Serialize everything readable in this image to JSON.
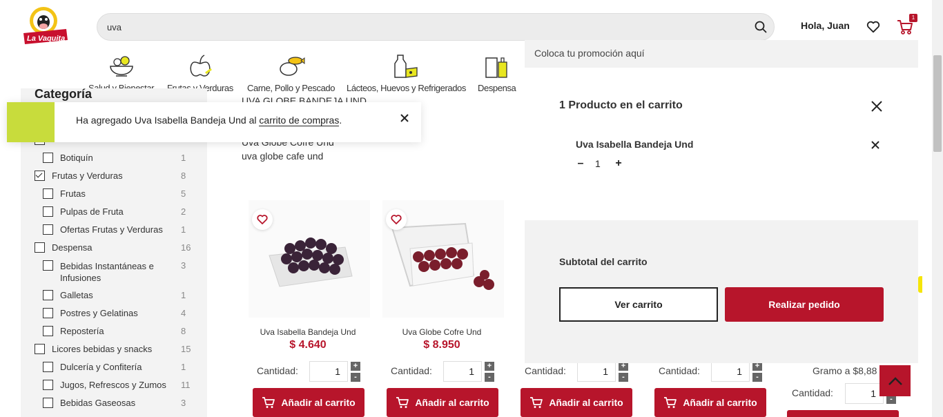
{
  "header": {
    "logo_text": "La Vaquita",
    "search_value": "uva",
    "greeting": "Hola, Juan",
    "cart_badge": "1"
  },
  "nav": {
    "categories": [
      {
        "label": "Salud y Bienestar"
      },
      {
        "label": "Frutas y Verduras"
      },
      {
        "label": "Carne, Pollo y Pescado"
      },
      {
        "label": "Lácteos, Huevos y Refrigerados"
      },
      {
        "label": "Despensa"
      }
    ]
  },
  "toast": {
    "prefix": "Ha agregado Uva Isabella Bandeja Und al ",
    "link": "carrito de compras",
    "suffix": "."
  },
  "sidebar": {
    "title": "Categoría",
    "items": [
      {
        "label": "Botiquín",
        "count": "1"
      },
      {
        "label": "Frutas y Verduras",
        "count": "8"
      },
      {
        "label": "Frutas",
        "count": "5"
      },
      {
        "label": "Pulpas de Fruta",
        "count": "2"
      },
      {
        "label": "Ofertas Frutas y Verduras",
        "count": "1"
      },
      {
        "label": "Despensa",
        "count": "16"
      },
      {
        "label": "Bebidas Instantáneas e",
        "label2": "Infusiones",
        "count": "3"
      },
      {
        "label": "Galletas",
        "count": "1"
      },
      {
        "label": "Postres y Gelatinas",
        "count": "4"
      },
      {
        "label": "Repostería",
        "count": "8"
      },
      {
        "label": "Licores bebidas y snacks",
        "count": "15"
      },
      {
        "label": "Dulcería y Confitería",
        "count": "1"
      },
      {
        "label": "Jugos, Refrescos y Zumos",
        "count": "11"
      },
      {
        "label": "Bebidas Gaseosas",
        "count": "3"
      }
    ]
  },
  "suggestions": [
    "UVA GLOBE BANDEJA UND",
    "Uva Globe Cofre Und",
    "uva globe cafe und"
  ],
  "products": [
    {
      "name": "Uva Isabella Bandeja Und",
      "price": "$ 4.640",
      "qty_label": "Cantidad:",
      "qty": "1",
      "add_label": "Añadir al carrito"
    },
    {
      "name": "Uva Globe Cofre Und",
      "price": "$ 8.950",
      "qty_label": "Cantidad:",
      "qty": "1",
      "add_label": "Añadir al carrito"
    },
    {
      "qty_label": "Cantidad:",
      "qty": "1",
      "add_label": "Añadir al carrito"
    },
    {
      "qty_label": "Cantidad:",
      "qty": "1",
      "add_label": "Añadir al carrito"
    },
    {
      "gramo": "Gramo a $8,88",
      "qty_label": "Cantidad:",
      "qty": "1"
    }
  ],
  "cart": {
    "promo": "Coloca tu promoción aquí",
    "title": "1 Producto en el carrito",
    "item_name": "Uva Isabella Bandeja Und",
    "item_qty": "1",
    "minus": "–",
    "plus": "+",
    "subtotal_label": "Subtotal del carrito",
    "view_cart": "Ver carrito",
    "checkout": "Realizar pedido"
  },
  "colors": {
    "brand_red": "#b7152b",
    "toast_accent": "#c8dc3c"
  },
  "icons": [
    "search-icon",
    "heart-icon",
    "cart-icon",
    "close-icon",
    "chevron-up-icon"
  ]
}
